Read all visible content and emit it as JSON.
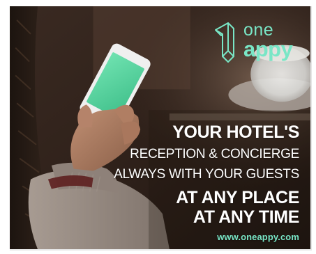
{
  "logo": {
    "line1": "one",
    "line2": "appy",
    "icon": "oneappy-logo-icon"
  },
  "headline": {
    "line1": "YOUR HOTEL'S",
    "line2": "RECEPTION & CONCIERGE",
    "line3": "ALWAYS WITH YOUR GUESTS",
    "line4": "AT ANY PLACE",
    "line5": "AT ANY TIME"
  },
  "website": "www.oneappy.com",
  "colors": {
    "accent": "#79e6c6",
    "text": "#ffffff",
    "background": "#2a1d17"
  }
}
